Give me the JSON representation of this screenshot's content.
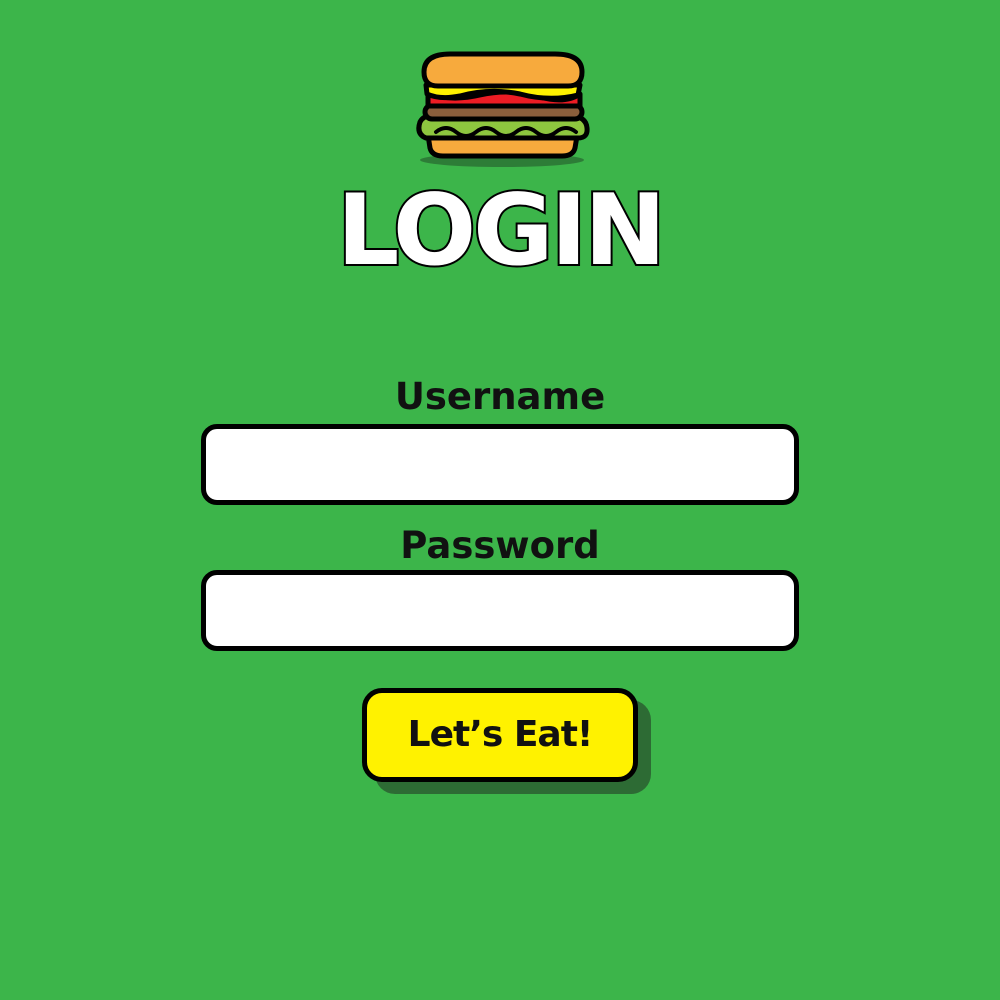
{
  "header": {
    "logo_icon": "burger-icon",
    "title": "LOGIN"
  },
  "form": {
    "username_label": "Username",
    "username_value": "",
    "password_label": "Password",
    "password_value": "",
    "submit_label": "Let’s Eat!"
  },
  "colors": {
    "background": "#3cb54a",
    "button": "#fff200",
    "button_shadow": "#2d6b34",
    "outline": "#000000"
  }
}
